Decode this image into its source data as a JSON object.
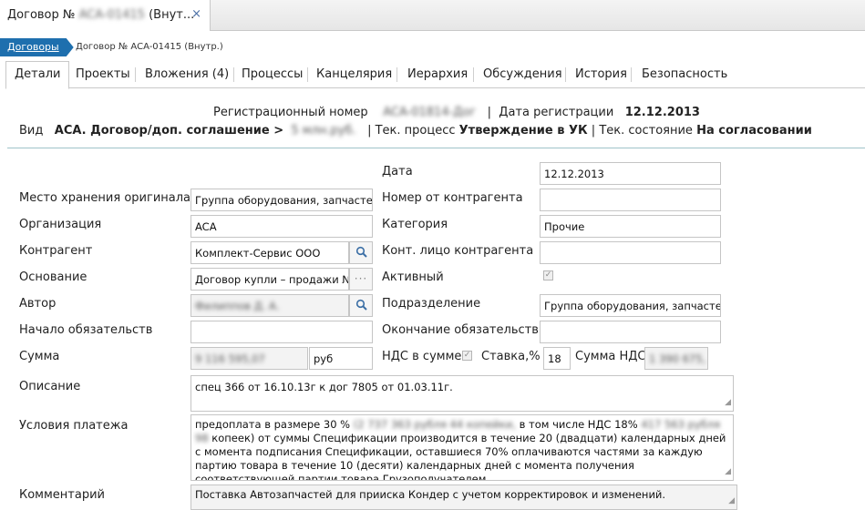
{
  "window_tab": {
    "title_prefix": "Договор №",
    "title_hidden": "ACA-01415",
    "title_suffix": "(Внут...",
    "close_glyph": "×"
  },
  "breadcrumb": {
    "link": "Договоры",
    "current": "Договор № ACA-01415 (Внутр.)"
  },
  "tabs": [
    "Детали",
    "Проекты",
    "Вложения (4)",
    "Процессы",
    "Канцелярия",
    "Иерархия",
    "Обсуждения",
    "История",
    "Безопасность"
  ],
  "header": {
    "reg_label": "Регистрационный номер",
    "reg_value": "ACA-01814-Дог",
    "sep": "|",
    "date_label": "Дата регистрации",
    "date_value": "12.12.2013",
    "kind_label": "Вид",
    "kind_value": "ACA. Договор/доп. соглашение >",
    "kind_hidden": "5 млн.руб.",
    "process_label": "Тек. процесс",
    "process_value": "Утверждение в УК",
    "state_label": "Тек. состояние",
    "state_value": "На согласовании"
  },
  "form": {
    "date_label": "Дата",
    "date_value": "12.12.2013",
    "storage_label": "Место хранения оригинала",
    "storage_value": "Группа оборудования, запчастей",
    "counterparty_num_label": "Номер от контрагента",
    "counterparty_num_value": "",
    "org_label": "Организация",
    "org_value": "ACA",
    "category_label": "Категория",
    "category_value": "Прочие",
    "counterparty_label": "Контрагент",
    "counterparty_value": "Комплект-Сервис ООО",
    "contact_label": "Конт. лицо контрагента",
    "contact_value": "",
    "basis_label": "Основание",
    "basis_value": "Договор купли – продажи №",
    "active_label": "Активный",
    "author_label": "Автор",
    "author_value": "Филиппов Д. А.",
    "division_label": "Подразделение",
    "division_value": "Группа оборудования, запчастей",
    "start_label": "Начало обязательств",
    "start_value": "",
    "end_label": "Окончание обязательств",
    "end_value": "",
    "sum_label": "Сумма",
    "sum_value": "9 116 595,07",
    "currency_value": "руб",
    "vat_in_sum_label": "НДС в сумме",
    "rate_label": "Ставка,%",
    "rate_value": "18",
    "vat_sum_label": "Сумма НДС",
    "vat_sum_value": "1 390 675,",
    "desc_label": "Описание",
    "desc_value": "спец 366 от 16.10.13г к дог 7805 от 01.03.11г.",
    "payment_label": "Условия платежа",
    "payment_text_1": "предоплата в размере 30 %",
    "payment_hidden_1": "(2 737 363 рубля 44 копейки,",
    "payment_text_2": "в том числе НДС 18%",
    "payment_hidden_2": "417 563 рубля 98",
    "payment_text_3": "копеек) от суммы Спецификации производится в течение 20 (двадцати) календарных дней с момента подписания Спецификации, оставшиеся 70% оплачиваются частями за каждую партию товара в течение 10 (десяти) календарных дней с момента получения соответствующей партии товара Грузополучателем.",
    "comment_label": "Комментарий",
    "comment_value": "Поставка Автозапчастей для прииска Кондер с учетом корректировок и изменений."
  },
  "icons": {
    "search": "search-icon",
    "more": "ellipsis-icon",
    "check": "checkmark-icon",
    "resize": "resize-grip-icon"
  },
  "colors": {
    "breadcrumb_bg": "#1e6fae",
    "divider": "#9fc3c9",
    "icon_blue": "#3a6ea5"
  }
}
